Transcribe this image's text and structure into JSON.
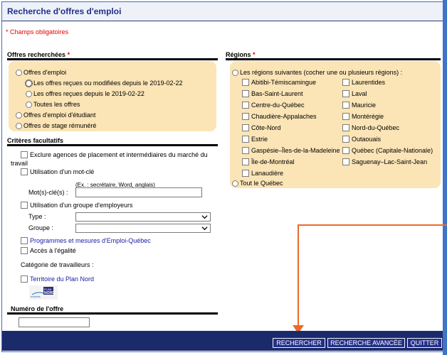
{
  "header": {
    "title": "Recherche d'offres d'emploi"
  },
  "required_note": "* Champs obligatoires",
  "offres": {
    "title": "Offres recherchées",
    "required_mark": "*",
    "offres_emploi": "Offres d'emploi",
    "recues_modifiees": "Les offres reçues ou modifiées depuis le 2019-02-22",
    "recues": "Les offres reçues depuis le 2019-02-22",
    "toutes": "Toutes les offres",
    "etudiant": "Offres d'emploi d'étudiant",
    "stage": "Offres de stage rémunéré"
  },
  "criteres": {
    "title": "Critères facultatifs",
    "exclure_line1": "Exclure agences de placement et intermédiaires du marché du",
    "exclure_line2": "travail",
    "mot_cle": "Utilisation d'un mot-clé",
    "mot_cle_example": "(Ex. : secrétaire, Word, anglais)",
    "mot_cle_label": "Mot(s)-clé(s) :",
    "mot_cle_value": "",
    "groupe_employeurs": "Utilisation d'un groupe d'employeurs",
    "type_label": "Type :",
    "type_value": "",
    "groupe_label": "Groupe :",
    "groupe_value": "",
    "programmes": "Programmes et mesures d'Emploi-Québec",
    "acces_egalite": "Accès à l'égalité",
    "categorie_label": "Catégorie de travailleurs :",
    "territoire": "Territoire du Plan Nord",
    "logo_text_1": "PLAN",
    "logo_text_2": "NORD",
    "logo_text_3": "emplois"
  },
  "numero": {
    "title": "Numéro de l'offre",
    "value": ""
  },
  "regions": {
    "title": "Régions",
    "required_mark": "*",
    "suivantes": "Les régions suivantes (cocher une ou plusieurs régions) :",
    "left": [
      "Abitibi-Témiscamingue",
      "Bas-Saint-Laurent",
      "Centre-du-Québec",
      "Chaudière-Appalaches",
      "Côte-Nord",
      "Estrie",
      "Gaspésie–Îles-de-la-Madeleine",
      "Île-de-Montréal",
      "Lanaudière"
    ],
    "right": [
      "Laurentides",
      "Laval",
      "Mauricie",
      "Montérégie",
      "Nord-du-Québec",
      "Outaouais",
      "Québec (Capitale-Nationale)",
      "Saguenay–Lac-Saint-Jean"
    ],
    "tout": "Tout le Québec"
  },
  "buttons": {
    "rechercher": "RECHERCHER",
    "avancee": "RECHERCHE AVANCÉE",
    "quitter": "QUITTER"
  },
  "colors": {
    "title_blue": "#23308a",
    "panel_bg": "#fbe4b6",
    "required_red": "#e30000",
    "annotation_orange": "#ea6a2a"
  }
}
